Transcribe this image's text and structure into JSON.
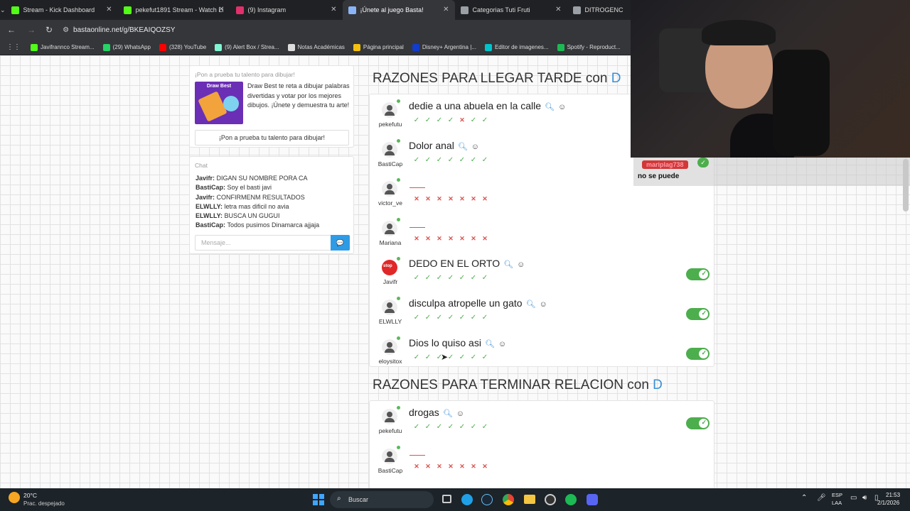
{
  "browser": {
    "tabs": [
      {
        "label": "Stream - Kick Dashboard",
        "color": "#53fc18",
        "active": false
      },
      {
        "label": "pekefut1891 Stream - Watch Li",
        "color": "#53fc18",
        "active": false
      },
      {
        "label": "(9) Instagram",
        "color": "#e1306c",
        "active": false
      },
      {
        "label": "¡Únete al juego Basta!",
        "color": "#8ab4f8",
        "active": true
      },
      {
        "label": "Categorias Tuti Fruti",
        "color": "#9aa0a6",
        "active": false
      },
      {
        "label": "DITROGENC",
        "color": "#9aa0a6",
        "active": false
      }
    ],
    "url": "bastaonline.net/g/BKEAIQOZSY",
    "bookmarks": [
      {
        "label": "Javifrannco Stream...",
        "color": "#53fc18"
      },
      {
        "label": "(29) WhatsApp",
        "color": "#25d366"
      },
      {
        "label": "(328) YouTube",
        "color": "#ff0000"
      },
      {
        "label": "(9) Alert Box / Strea...",
        "color": "#80f5d2"
      },
      {
        "label": "Notas Académicas",
        "color": "#dddddd"
      },
      {
        "label": "Página principal",
        "color": "#f4c20d"
      },
      {
        "label": "Disney+ Argentina |...",
        "color": "#113ccf"
      },
      {
        "label": "Editor de imagenes...",
        "color": "#00c4cc"
      },
      {
        "label": "Spotify - Reproduct...",
        "color": "#1db954"
      }
    ]
  },
  "promo": {
    "heading": "¡Pon a prueba tu talento para dibujar!",
    "image_title": "Draw Best",
    "text": "Draw Best te reta a dibujar palabras divertidas y votar por los mejores dibujos. ¡Únete y demuestra tu arte!",
    "button": "¡Pon a prueba tu talento para dibujar!"
  },
  "chat": {
    "heading": "Chat",
    "messages": [
      {
        "user": "Javifr",
        "text": "DIGAN SU NOMBRE PORA CA"
      },
      {
        "user": "BastiCap",
        "text": "Soy el basti javi"
      },
      {
        "user": "Javifr",
        "text": "CONFIRMENM RESULTADOS"
      },
      {
        "user": "ELWLLY",
        "text": "letra mas dificil no avia"
      },
      {
        "user": "ELWLLY",
        "text": "BUSCA UN GUGUI"
      },
      {
        "user": "BastiCap",
        "text": "Todos pusimos Dinamarca ajjaja"
      }
    ],
    "placeholder": "Mensaje..."
  },
  "sections": [
    {
      "title": "RAZONES PARA LLEGAR TARDE con",
      "letter": "D",
      "rows": [
        {
          "user": "pekefutu",
          "answer": "dedie a una abuela en la calle",
          "votes": [
            "ok",
            "ok",
            "ok",
            "ok",
            "no",
            "ok",
            "ok"
          ],
          "toggle": false
        },
        {
          "user": "BastiCap",
          "answer": "Dolor anal",
          "votes": [
            "ok",
            "ok",
            "ok",
            "ok",
            "ok",
            "ok",
            "ok"
          ],
          "toggle": false
        },
        {
          "user": "victor_ve",
          "answer": "",
          "votes": [
            "no",
            "no",
            "no",
            "no",
            "no",
            "no",
            "no"
          ],
          "toggle": false
        },
        {
          "user": "Mariana",
          "answer": "",
          "votes": [
            "no",
            "no",
            "no",
            "no",
            "no",
            "no",
            "no"
          ],
          "toggle": false
        },
        {
          "user": "Javifr",
          "answer": "DEDO EN EL ORTO",
          "votes": [
            "ok",
            "ok",
            "ok",
            "ok",
            "ok",
            "ok",
            "ok"
          ],
          "toggle": true,
          "stop": true
        },
        {
          "user": "ELWLLY",
          "answer": "disculpa atropelle un gato",
          "votes": [
            "ok",
            "ok",
            "ok",
            "ok",
            "ok",
            "ok",
            "ok"
          ],
          "toggle": true
        },
        {
          "user": "eloysitox",
          "answer": "Dios lo quiso asi",
          "votes": [
            "ok",
            "ok",
            "ok",
            "ok",
            "ok",
            "ok",
            "ok"
          ],
          "toggle": true
        }
      ]
    },
    {
      "title": "RAZONES PARA TERMINAR RELACION con",
      "letter": "D",
      "rows": [
        {
          "user": "pekefutu",
          "answer": "drogas",
          "votes": [
            "ok",
            "ok",
            "ok",
            "ok",
            "ok",
            "ok",
            "ok"
          ],
          "toggle": true
        },
        {
          "user": "BastiCap",
          "answer": "",
          "votes": [
            "no",
            "no",
            "no",
            "no",
            "no",
            "no",
            "no"
          ],
          "toggle": false
        }
      ]
    }
  ],
  "overlay": {
    "username": "mariplag738",
    "message": "no se puede"
  },
  "taskbar": {
    "temp": "20°C",
    "weather": "Prac. despejado",
    "search": "Buscar",
    "lang1": "ESP",
    "lang2": "LAA",
    "time": "21:53",
    "date": "2/1/2026"
  }
}
